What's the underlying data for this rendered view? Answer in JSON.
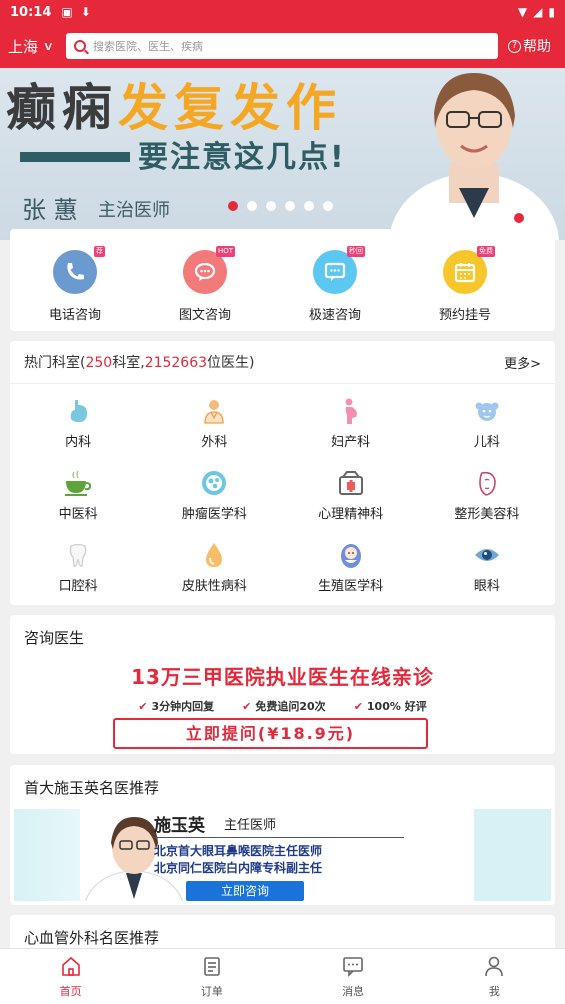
{
  "status_bar": {
    "time": "10:14"
  },
  "header": {
    "city": "上海",
    "search_placeholder": "搜索医院、医生、疾病",
    "help": "帮助"
  },
  "banner": {
    "headline_a": "癫痫",
    "headline_b": "发复发作",
    "subline": "要注意这几点!",
    "doctor_name": "张 蕙",
    "doctor_title": "主治医师",
    "slide_count": 6,
    "active_slide": 1
  },
  "services": [
    {
      "label": "电话咨询",
      "badge": "荐",
      "icon": "phone-icon",
      "color": "#6a9ad0"
    },
    {
      "label": "图文咨询",
      "badge": "HOT",
      "icon": "chat-icon",
      "color": "#f27a7a"
    },
    {
      "label": "极速咨询",
      "badge": "秒回",
      "icon": "message-icon",
      "color": "#5cc8f2"
    },
    {
      "label": "预约挂号",
      "badge": "免费",
      "icon": "calendar-icon",
      "color": "#f7c62a"
    }
  ],
  "departments": {
    "title_prefix": "热门科室(",
    "dept_count": "250",
    "mid": "科室,",
    "doctor_count": "2152663",
    "suffix": "位医生)",
    "more": "更多>",
    "items": [
      {
        "label": "内科",
        "icon": "stomach-icon"
      },
      {
        "label": "外科",
        "icon": "surgeon-icon"
      },
      {
        "label": "妇产科",
        "icon": "pregnant-icon"
      },
      {
        "label": "儿科",
        "icon": "baby-icon"
      },
      {
        "label": "中医科",
        "icon": "tea-cup-icon"
      },
      {
        "label": "肿瘤医学科",
        "icon": "cell-icon"
      },
      {
        "label": "心理精神科",
        "icon": "brain-box-icon"
      },
      {
        "label": "整形美容科",
        "icon": "face-icon"
      },
      {
        "label": "口腔科",
        "icon": "tooth-icon"
      },
      {
        "label": "皮肤性病科",
        "icon": "droplet-icon"
      },
      {
        "label": "生殖医学科",
        "icon": "infant-icon"
      },
      {
        "label": "眼科",
        "icon": "eye-icon"
      }
    ]
  },
  "consult": {
    "title": "咨询医生",
    "headline": "13万三甲医院执业医生在线亲诊",
    "features": [
      "3分钟内回复",
      "免费追问20次",
      "100% 好评"
    ],
    "button": "立即提问(¥18.9元)"
  },
  "recommend": {
    "title": "首大施玉英名医推荐",
    "doctor_name": "施玉英",
    "doctor_title": "主任医师",
    "line1": "北京首大眼耳鼻喉医院主任医师",
    "line2": "北京同仁医院白内障专科副主任",
    "button": "立即咨询"
  },
  "next_section": {
    "title": "心血管外科名医推荐"
  },
  "bottom_nav": [
    {
      "label": "首页",
      "icon": "home-icon",
      "active": true
    },
    {
      "label": "订单",
      "icon": "order-icon",
      "active": false
    },
    {
      "label": "消息",
      "icon": "message-icon",
      "active": false
    },
    {
      "label": "我",
      "icon": "user-icon",
      "active": false
    }
  ],
  "colors": {
    "brand_red": "#e5283a",
    "badge_pink": "#f0407a",
    "accent_blue": "#1a73d9"
  }
}
